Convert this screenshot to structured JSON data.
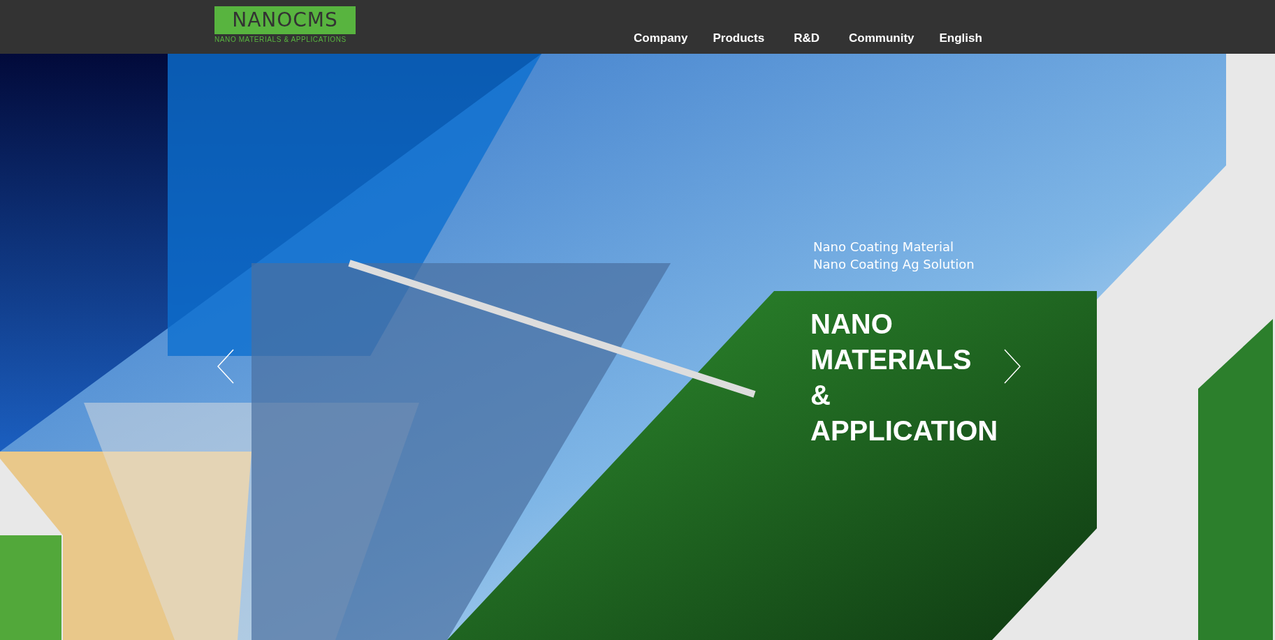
{
  "header": {
    "logo": {
      "name": "NANOCMS",
      "tagline": "NANO MATERIALS & APPLICATIONS"
    },
    "nav": [
      {
        "label": "Company"
      },
      {
        "label": "Products"
      },
      {
        "label": "R&D"
      },
      {
        "label": "Community"
      },
      {
        "label": "English"
      }
    ]
  },
  "hero": {
    "subtitles": [
      "Nano Coating Material",
      "Nano Coating Ag Solution"
    ],
    "title_lines": [
      "NANO",
      "MATERIALS",
      "&",
      "APPLICATION"
    ]
  }
}
